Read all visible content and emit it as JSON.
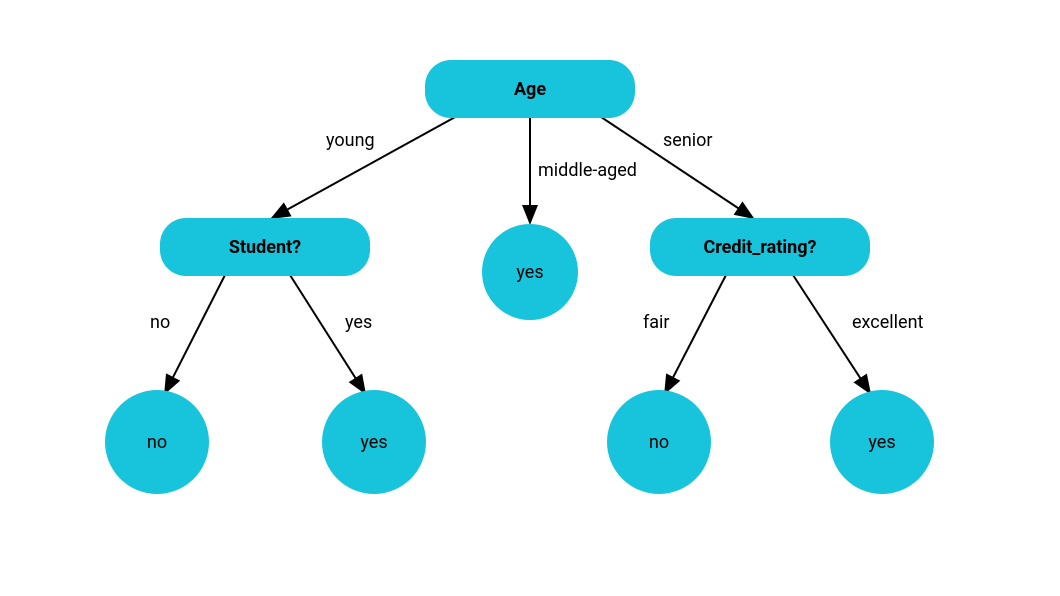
{
  "colors": {
    "node_fill": "#18c3dc",
    "edge_stroke": "#000000",
    "bg": "#ffffff"
  },
  "nodes": {
    "root": {
      "label": "Age",
      "shape": "rounded-rect"
    },
    "student": {
      "label": "Student?",
      "shape": "rounded-rect"
    },
    "credit": {
      "label": "Credit_rating?",
      "shape": "rounded-rect"
    },
    "middle_leaf": {
      "label": "yes",
      "shape": "circle"
    },
    "student_no_leaf": {
      "label": "no",
      "shape": "circle"
    },
    "student_yes_leaf": {
      "label": "yes",
      "shape": "circle"
    },
    "credit_fair_leaf": {
      "label": "no",
      "shape": "circle"
    },
    "credit_excellent_leaf": {
      "label": "yes",
      "shape": "circle"
    }
  },
  "edges": {
    "root_to_student": {
      "label": "young"
    },
    "root_to_middle": {
      "label": "middle-aged"
    },
    "root_to_credit": {
      "label": "senior"
    },
    "student_to_no": {
      "label": "no"
    },
    "student_to_yes": {
      "label": "yes"
    },
    "credit_to_fair": {
      "label": "fair"
    },
    "credit_to_excellent": {
      "label": "excellent"
    }
  }
}
